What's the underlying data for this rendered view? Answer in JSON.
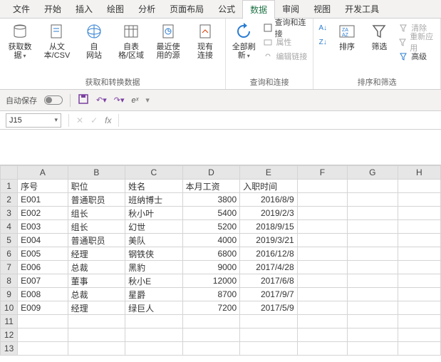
{
  "menu": [
    "文件",
    "开始",
    "插入",
    "绘图",
    "分析",
    "页面布局",
    "公式",
    "数据",
    "审阅",
    "视图",
    "开发工具"
  ],
  "active_tab": "数据",
  "ribbon": {
    "g1": {
      "label": "获取和转换数据",
      "btns": [
        {
          "l": "获取数\n据",
          "dd": true
        },
        {
          "l": "从文\n本/CSV"
        },
        {
          "l": "自\n网站"
        },
        {
          "l": "自表\n格/区域"
        },
        {
          "l": "最近使\n用的源"
        },
        {
          "l": "现有\n连接"
        }
      ]
    },
    "g2": {
      "label": "查询和连接",
      "main": {
        "l": "全部刷新",
        "dd": true
      },
      "side": [
        {
          "l": "查询和连接"
        },
        {
          "l": "属性",
          "disabled": true
        },
        {
          "l": "编辑链接",
          "disabled": true
        }
      ]
    },
    "g3": {
      "label": "排序和筛选",
      "az": "A↓Z",
      "za": "Z↓A",
      "sort": "排序",
      "filter": "筛选",
      "side": [
        {
          "l": "清除",
          "disabled": true
        },
        {
          "l": "重新应用",
          "disabled": true
        },
        {
          "l": "高级"
        }
      ]
    }
  },
  "qat": {
    "autosave": "自动保存",
    "fx": "e^x"
  },
  "namebox": "J15",
  "columns": [
    "A",
    "B",
    "C",
    "D",
    "E",
    "F",
    "G",
    "H"
  ],
  "row_headers": [
    1,
    2,
    3,
    4,
    5,
    6,
    7,
    8,
    9,
    10,
    11,
    12,
    13
  ],
  "headers_row": [
    "序号",
    "职位",
    "姓名",
    "本月工资",
    "入职时间"
  ],
  "data": [
    [
      "E001",
      "普通职员",
      "班纳博士",
      "3800",
      "2016/8/9"
    ],
    [
      "E002",
      "组长",
      "秋小叶",
      "5400",
      "2019/2/3"
    ],
    [
      "E003",
      "组长",
      "幻世",
      "5200",
      "2018/9/15"
    ],
    [
      "E004",
      "普通职员",
      "美队",
      "4000",
      "2019/3/21"
    ],
    [
      "E005",
      "经理",
      "钢铁侠",
      "6800",
      "2016/12/8"
    ],
    [
      "E006",
      "总裁",
      "黑豹",
      "9000",
      "2017/4/28"
    ],
    [
      "E007",
      "董事",
      "秋小E",
      "12000",
      "2017/6/8"
    ],
    [
      "E008",
      "总裁",
      "星爵",
      "8700",
      "2017/9/7"
    ],
    [
      "E009",
      "经理",
      "绿巨人",
      "7200",
      "2017/5/9"
    ]
  ]
}
